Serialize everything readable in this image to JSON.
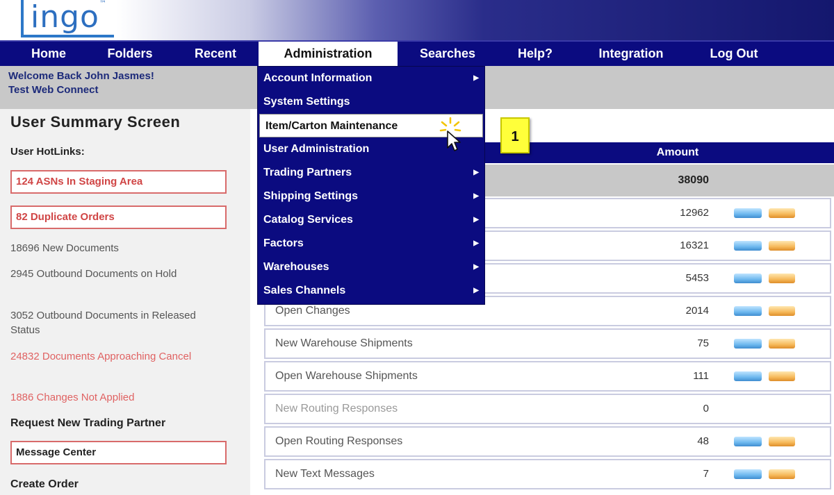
{
  "brand": {
    "logo_text": "ingo",
    "logo_mark": "™"
  },
  "nav": {
    "items": [
      "Home",
      "Folders",
      "Recent",
      "Administration",
      "Searches",
      "Help?",
      "Integration",
      "Log Out"
    ],
    "active_index": 3
  },
  "welcome": {
    "line1": "Welcome Back John Jasmes!",
    "line2": "Test Web Connect"
  },
  "left": {
    "title": "User Summary Screen",
    "hotlinks_label": "User HotLinks:",
    "links": [
      {
        "text": "124 ASNs In Staging Area",
        "style": "boxed-red"
      },
      {
        "text": "82 Duplicate Orders",
        "style": "boxed-red"
      },
      {
        "text": "18696 New Documents",
        "style": "gray"
      },
      {
        "text": "2945 Outbound Documents on Hold",
        "style": "gray"
      },
      {
        "text": "3052 Outbound Documents in Released Status",
        "style": "gray"
      },
      {
        "text": "24832 Documents Approaching Cancel",
        "style": "red"
      },
      {
        "text": "1886 Changes Not Applied",
        "style": "red"
      },
      {
        "text": "Request New Trading Partner",
        "style": "bold"
      },
      {
        "text": "Message Center",
        "style": "boxed-dark"
      },
      {
        "text": "Create Order",
        "style": "bold"
      }
    ]
  },
  "table": {
    "amount_header": "Amount",
    "total": "38090",
    "rows": [
      {
        "label": "",
        "value": "12962",
        "icons": true
      },
      {
        "label": "",
        "value": "16321",
        "icons": true
      },
      {
        "label": "",
        "value": "5453",
        "icons": true
      },
      {
        "label": "Open Changes",
        "value": "2014",
        "icons": true
      },
      {
        "label": "New Warehouse Shipments",
        "value": "75",
        "icons": true
      },
      {
        "label": "Open Warehouse Shipments",
        "value": "111",
        "icons": true
      },
      {
        "label": "New Routing Responses",
        "value": "0",
        "icons": false
      },
      {
        "label": "Open Routing Responses",
        "value": "48",
        "icons": true
      },
      {
        "label": "New Text Messages",
        "value": "7",
        "icons": true
      }
    ]
  },
  "dropdown": {
    "items": [
      {
        "label": "Account Information",
        "submenu": true
      },
      {
        "label": "System Settings",
        "submenu": false
      },
      {
        "label": "Item/Carton Maintenance",
        "submenu": false,
        "hover": true
      },
      {
        "label": "User Administration",
        "submenu": false
      },
      {
        "label": "Trading Partners",
        "submenu": true
      },
      {
        "label": "Shipping Settings",
        "submenu": true
      },
      {
        "label": "Catalog Services",
        "submenu": true
      },
      {
        "label": "Factors",
        "submenu": true
      },
      {
        "label": "Warehouses",
        "submenu": true
      },
      {
        "label": "Sales Channels",
        "submenu": true
      }
    ]
  },
  "callout": {
    "text": "1"
  },
  "icons": {
    "view": "view-icon",
    "edit": "folder-icon",
    "submenu": "triangle-right-icon",
    "cursor": "cursor-icon"
  },
  "colors": {
    "nav_bg": "#0b0b80",
    "accent_red": "#d04545",
    "callout_yellow": "#ffff3a"
  }
}
